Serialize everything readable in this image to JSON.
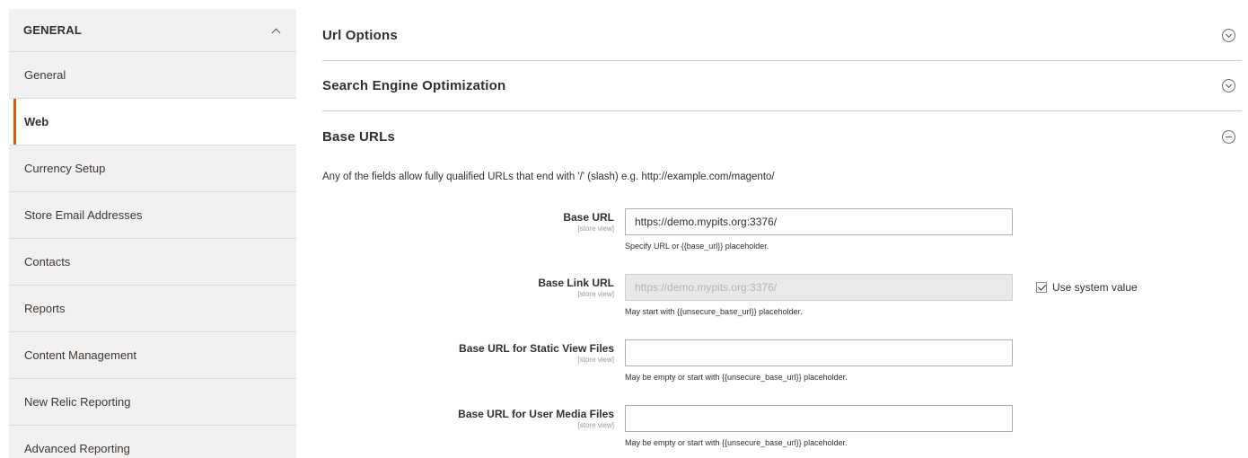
{
  "sidebar": {
    "header": "GENERAL",
    "items": [
      {
        "label": "General",
        "active": false
      },
      {
        "label": "Web",
        "active": true
      },
      {
        "label": "Currency Setup",
        "active": false
      },
      {
        "label": "Store Email Addresses",
        "active": false
      },
      {
        "label": "Contacts",
        "active": false
      },
      {
        "label": "Reports",
        "active": false
      },
      {
        "label": "Content Management",
        "active": false
      },
      {
        "label": "New Relic Reporting",
        "active": false
      },
      {
        "label": "Advanced Reporting",
        "active": false
      }
    ]
  },
  "sections": {
    "url_options": "Url Options",
    "seo": "Search Engine Optimization",
    "base_urls": "Base URLs"
  },
  "base_urls": {
    "description": "Any of the fields allow fully qualified URLs that end with '/' (slash) e.g. http://example.com/magento/",
    "fields": [
      {
        "label": "Base URL",
        "scope": "[store view]",
        "value": "https://demo.mypits.org:3376/",
        "note": "Specify URL or {{base_url}} placeholder."
      },
      {
        "label": "Base Link URL",
        "scope": "[store view]",
        "value": "https://demo.mypits.org:3376/",
        "note": "May start with {{unsecure_base_url}} placeholder.",
        "system_value_label": "Use system value"
      },
      {
        "label": "Base URL for Static View Files",
        "scope": "[store view]",
        "value": "",
        "note": "May be empty or start with {{unsecure_base_url}} placeholder."
      },
      {
        "label": "Base URL for User Media Files",
        "scope": "[store view]",
        "value": "",
        "note": "May be empty or start with {{unsecure_base_url}} placeholder."
      }
    ]
  },
  "colors": {
    "accent": "#eb5202",
    "sidebar_bg": "#f1f1f1"
  }
}
